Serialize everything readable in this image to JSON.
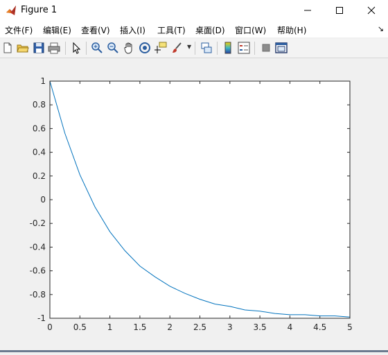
{
  "window": {
    "title": "Figure 1",
    "controls": {
      "minimize": "minimize-icon",
      "maximize": "maximize-icon",
      "close": "close-icon"
    }
  },
  "menu": {
    "items": [
      "文件(F)",
      "编辑(E)",
      "查看(V)",
      "插入(I)",
      "工具(T)",
      "桌面(D)",
      "窗口(W)",
      "帮助(H)"
    ],
    "dock_glyph": "↘"
  },
  "toolbar": {
    "icons": [
      "new-figure-icon",
      "open-file-icon",
      "save-icon",
      "print-icon",
      "edit-plot-arrow-icon",
      "zoom-in-icon",
      "zoom-out-icon",
      "pan-hand-icon",
      "rotate-3d-icon",
      "data-cursor-icon",
      "brush-icon",
      "link-plot-icon",
      "colorbar-icon",
      "legend-icon",
      "hide-tools-icon",
      "dock-figure-icon"
    ]
  },
  "chart_data": {
    "type": "line",
    "title": "",
    "xlabel": "",
    "ylabel": "",
    "xlim": [
      0,
      5
    ],
    "ylim": [
      -1,
      1
    ],
    "xticks": [
      "0",
      "0.5",
      "1",
      "1.5",
      "2",
      "2.5",
      "3",
      "3.5",
      "4",
      "4.5",
      "5"
    ],
    "yticks": [
      "-1",
      "-0.8",
      "-0.6",
      "-0.4",
      "-0.2",
      "0",
      "0.2",
      "0.4",
      "0.6",
      "0.8",
      "1"
    ],
    "grid": false,
    "line_color": "#0072bd",
    "series": [
      {
        "x": [
          0,
          0.25,
          0.5,
          0.75,
          1,
          1.25,
          1.5,
          1.75,
          2,
          2.25,
          2.5,
          2.75,
          3,
          3.25,
          3.5,
          3.75,
          4,
          4.25,
          4.5,
          4.75,
          5
        ],
        "y": [
          1,
          0.56,
          0.21,
          -0.06,
          -0.27,
          -0.43,
          -0.56,
          -0.65,
          -0.73,
          -0.79,
          -0.84,
          -0.88,
          -0.9,
          -0.93,
          -0.94,
          -0.96,
          -0.97,
          -0.97,
          -0.98,
          -0.98,
          -0.99
        ]
      }
    ]
  }
}
